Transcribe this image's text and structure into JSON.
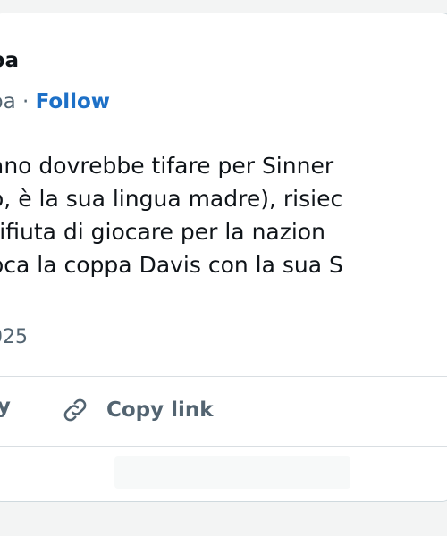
{
  "tweet": {
    "author_name": "pa",
    "handle_partial": "pa",
    "separator": " · ",
    "follow_label": "Follow",
    "body_lines": [
      "ano dovrebbe tifare per Sinner",
      "o, è la sua lingua madre), risiec",
      "rifiuta di giocare per la nazion",
      "oca la coppa Davis con la sua S"
    ],
    "date_partial": "025"
  },
  "actions": {
    "reply_partial": "ly",
    "copy_link_label": "Copy link",
    "copy_link_icon": "link-icon"
  },
  "colors": {
    "follow": "#1d70c7",
    "secondary_text": "#536471",
    "border": "#cfd9de"
  }
}
